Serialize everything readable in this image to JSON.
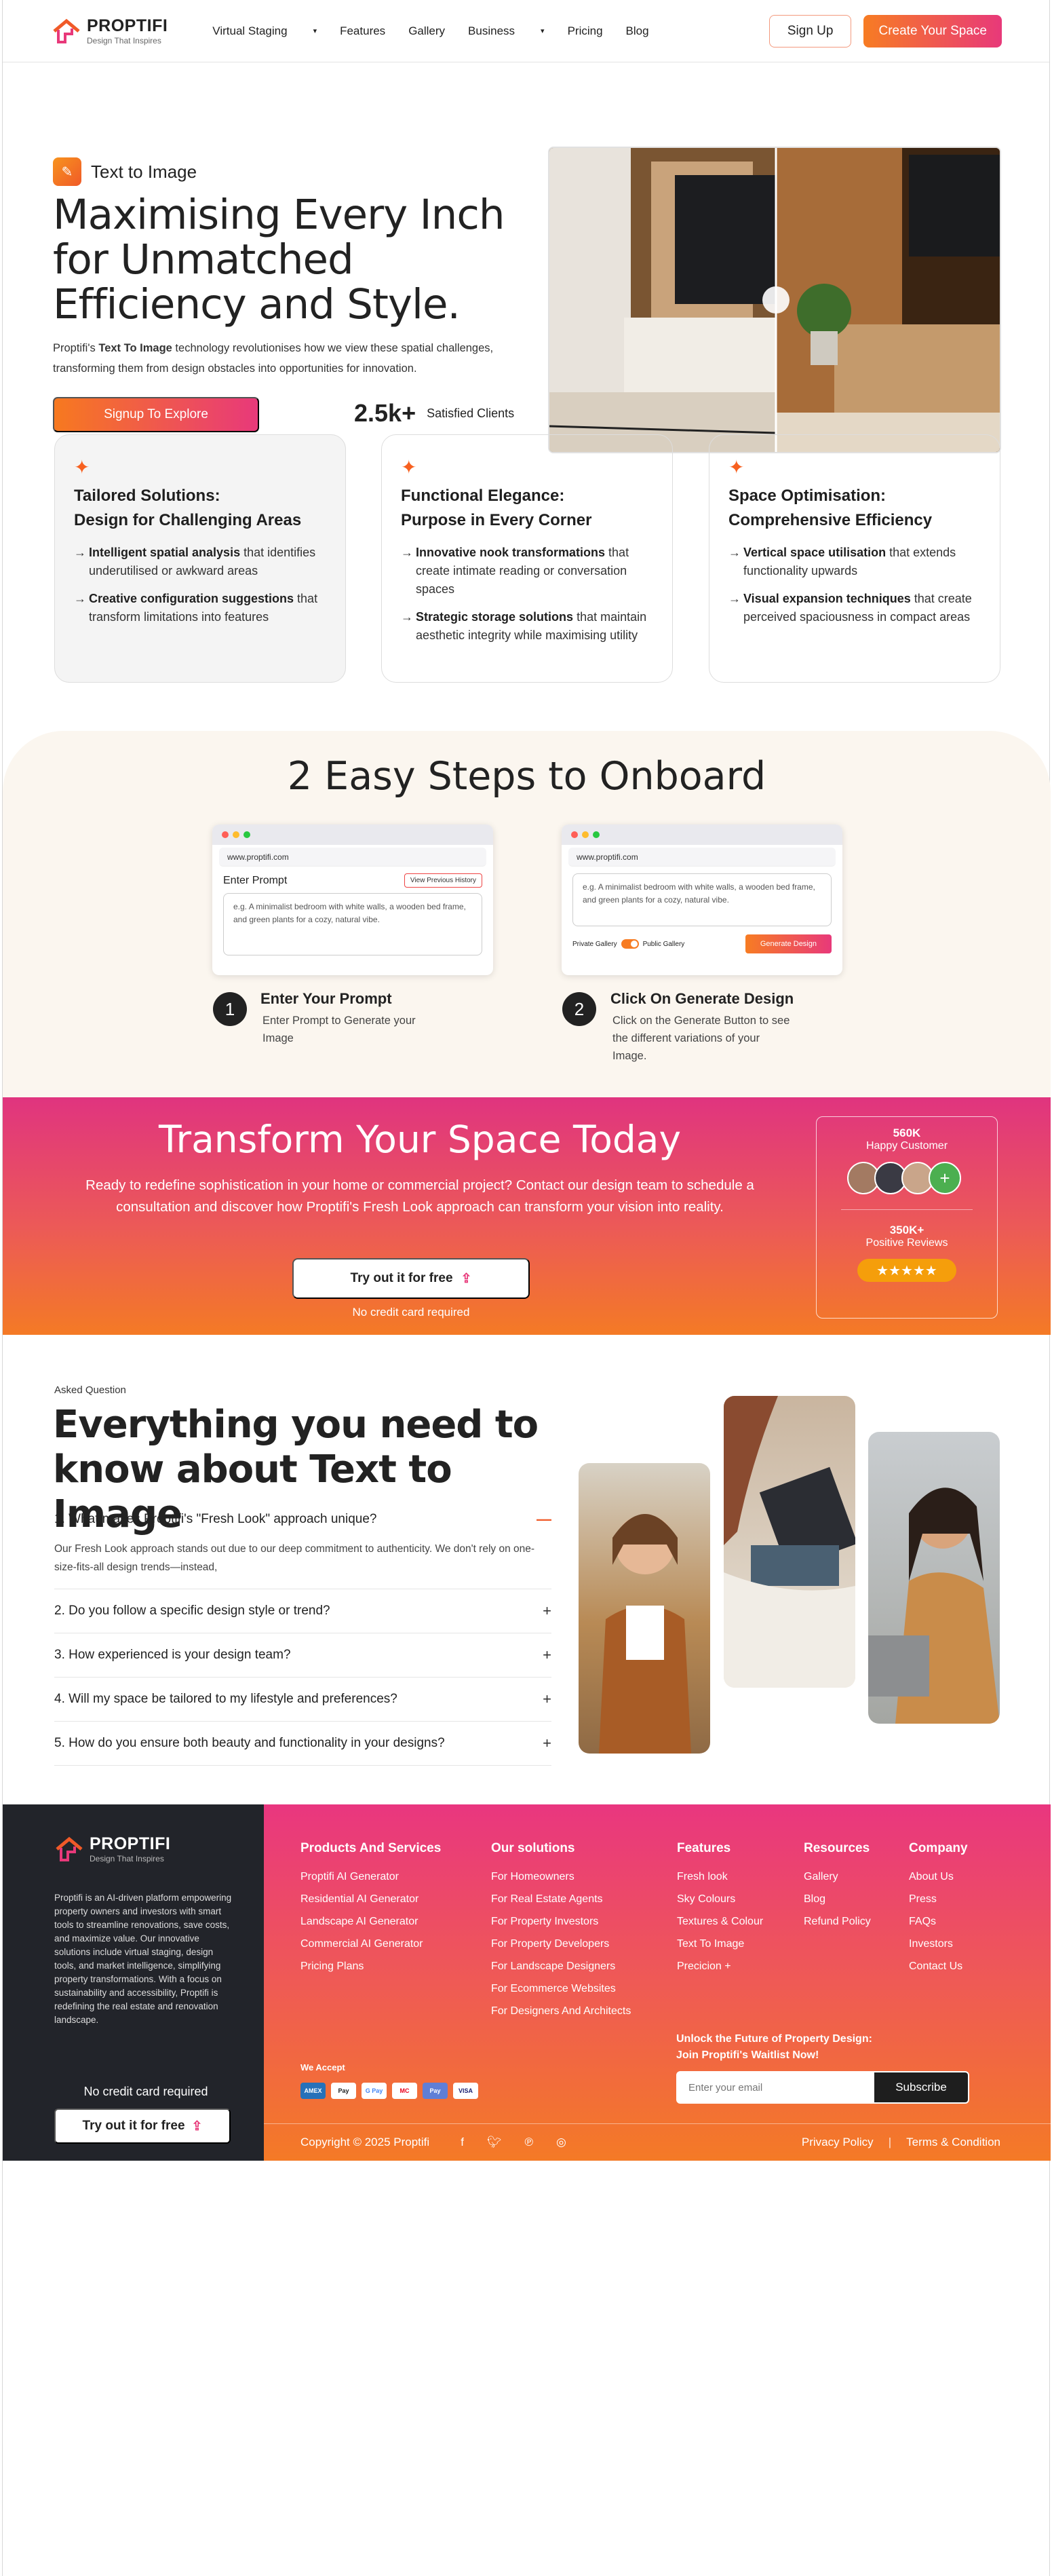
{
  "header": {
    "logo_name": "PROPTIFI",
    "logo_tagline": "Design That Inspires",
    "nav": [
      {
        "label": "Virtual Staging",
        "dropdown": true
      },
      {
        "label": "Features",
        "dropdown": false
      },
      {
        "label": "Gallery",
        "dropdown": false
      },
      {
        "label": "Business",
        "dropdown": true
      },
      {
        "label": "Pricing",
        "dropdown": false
      },
      {
        "label": "Blog",
        "dropdown": false
      }
    ],
    "signup_label": "Sign Up",
    "create_label": "Create Your Space"
  },
  "hero": {
    "badge": "Text to Image",
    "title": "Maximising Every Inch for Unmatched Efficiency and Style.",
    "desc_prefix": "Proptifi's ",
    "desc_bold": "Text To Image",
    "desc_suffix": " technology revolutionises how we view these spatial challenges, transforming them from design obstacles into opportunities for innovation.",
    "cta": "Signup To Explore",
    "stat_num": "2.5k+",
    "stat_label": "Satisfied Clients"
  },
  "features": [
    {
      "title_line1": "Tailored Solutions:",
      "title_line2": "Design for Challenging Areas",
      "items": [
        {
          "bold": "Intelligent spatial analysis",
          "text": " that identifies underutilised or awkward areas"
        },
        {
          "bold": "Creative configuration suggestions",
          "text": " that transform limitations into features"
        }
      ]
    },
    {
      "title_line1": "Functional Elegance:",
      "title_line2": "Purpose in Every Corner",
      "items": [
        {
          "bold": "Innovative nook transformations",
          "text": " that create intimate reading or conversation spaces"
        },
        {
          "bold": "Strategic storage solutions",
          "text": " that maintain aesthetic integrity while maximising utility"
        }
      ]
    },
    {
      "title_line1": "Space Optimisation:",
      "title_line2": "Comprehensive Efficiency",
      "items": [
        {
          "bold": "Vertical space utilisation",
          "text": " that extends functionality upwards"
        },
        {
          "bold": "Visual expansion techniques",
          "text": " that create perceived spaciousness in compact areas"
        }
      ]
    }
  ],
  "steps": {
    "title": "2 Easy Steps to Onboard",
    "url": "www.proptifi.com",
    "enter_prompt": "Enter Prompt",
    "history_btn": "View Previous History",
    "prompt_placeholder": "e.g. A minimalist bedroom with white walls, a wooden bed frame, and green plants for a cozy, natural vibe.",
    "private_gallery": "Private Gallery",
    "public_gallery": "Public Gallery",
    "generate_btn": "Generate Design",
    "step1_num": "1",
    "step1_title": "Enter Your Prompt",
    "step1_desc": "Enter Prompt to Generate your Image",
    "step2_num": "2",
    "step2_title": "Click On Generate Design",
    "step2_desc": "Click on the Generate Button to see the different variations of your Image."
  },
  "transform": {
    "title": "Transform Your Space Today",
    "desc": "Ready to redefine sophistication in your home or commercial project?  Contact our design team to schedule a consultation and discover how Proptifi's Fresh Look approach can transform your vision into reality.",
    "btn": "Try out it for free",
    "note": "No credit card required",
    "customers_num": "560K",
    "customers_label": "Happy Customer",
    "reviews_num": "350K+",
    "reviews_label": "Positive Reviews",
    "stars": "★★★★★"
  },
  "faq": {
    "kicker": "Asked Question",
    "title": "Everything you need to know about Text to Image",
    "items": [
      {
        "q": "1. What makes Proptifi's \"Fresh Look\" approach unique?",
        "a": "Our Fresh Look approach stands out due to our deep commitment to authenticity. We don't rely on one-size-fits-all design trends—instead,"
      },
      {
        "q": "2. Do you follow a specific design style or trend?"
      },
      {
        "q": "3. How experienced is your design team?"
      },
      {
        "q": "4. Will my space be tailored to my lifestyle and preferences?"
      },
      {
        "q": "5. How do you ensure both beauty and functionality in your designs?"
      }
    ]
  },
  "footer": {
    "logo_name": "PROPTIFI",
    "logo_tagline": "Design That Inspires",
    "about": "Proptifi is an AI-driven platform empowering property owners and investors with smart tools to streamline renovations, save costs, and maximize value. Our innovative solutions include virtual staging, design tools, and market intelligence, simplifying property transformations. With a focus on sustainability and accessibility, Proptifi is redefining the real estate and renovation landscape.",
    "note": "No credit card required",
    "btn": "Try out it for free",
    "columns": [
      {
        "title": "Products And Services",
        "links": [
          "Proptifi AI Generator",
          "Residential AI Generator",
          "Landscape AI Generator",
          "Commercial AI Generator",
          "Pricing Plans"
        ]
      },
      {
        "title": "Our solutions",
        "links": [
          "For Homeowners",
          "For Real Estate Agents",
          "For Property Investors",
          "For Property Developers",
          "For Landscape Designers",
          "For Ecommerce Websites",
          "For Designers And Architects"
        ]
      },
      {
        "title": "Features",
        "links": [
          "Fresh look",
          "Sky Colours",
          "Textures & Colour",
          "Text To Image",
          "Precicion +"
        ]
      },
      {
        "title": "Resources",
        "links": [
          "Gallery",
          "Blog",
          "Refund Policy"
        ]
      },
      {
        "title": "Company",
        "links": [
          "About Us",
          "Press",
          "FAQs",
          "Investors",
          "Contact Us"
        ]
      }
    ],
    "we_accept": "We Accept",
    "payments": [
      "AMEX",
      "Pay",
      "G Pay",
      "MC",
      "Pay",
      "VISA"
    ],
    "waitlist_line1": "Unlock the Future of Property Design:",
    "waitlist_line2": "Join Proptifi's Waitlist Now!",
    "email_placeholder": "Enter your email",
    "subscribe": "Subscribe",
    "copyright": "Copyright © 2025 Proptifi",
    "privacy": "Privacy Policy",
    "terms": "Terms & Condition"
  },
  "colors": {
    "accent_orange": "#f7791f",
    "accent_pink": "#e8397a",
    "dark": "#22242a"
  }
}
